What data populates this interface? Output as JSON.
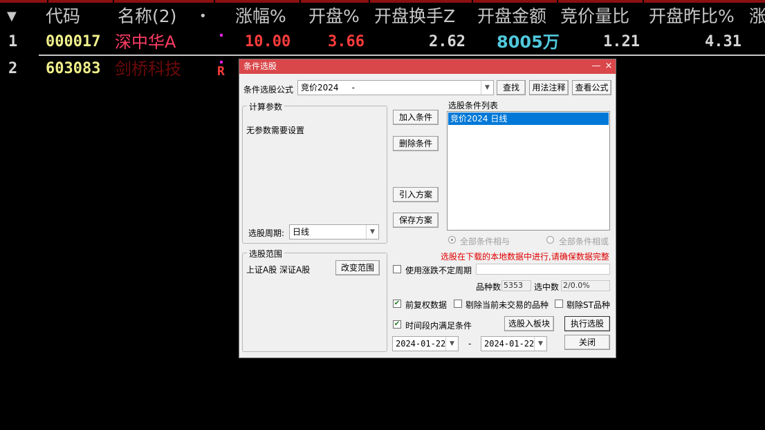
{
  "table": {
    "columns": [
      {
        "label": "代码"
      },
      {
        "label": "名称(2)"
      },
      {
        "label": "•"
      },
      {
        "label": "涨幅%"
      },
      {
        "label": "开盘%"
      },
      {
        "label": "开盘换手Z"
      },
      {
        "label": "开盘金额"
      },
      {
        "label": "竞价量比"
      },
      {
        "label": "开盘昨比%"
      },
      {
        "label": "涨"
      }
    ],
    "sort_indicator": "▼",
    "rows": [
      {
        "index": "1",
        "code": "000017",
        "name": "深中华A",
        "chg": "10.00",
        "open_pct": "3.66",
        "turnover": "2.62",
        "amount": "8005万",
        "vol_ratio": "1.21",
        "open_prev": "4.31"
      },
      {
        "index": "2",
        "code": "603083",
        "name": "剑桥科技",
        "flag": "R"
      }
    ]
  },
  "dialog": {
    "title": "条件选股",
    "minimize": "—",
    "close": "×",
    "formula_label": "条件选股公式",
    "formula_value": "竞价2024     -",
    "find_button": "查找",
    "usage_button": "用法注释",
    "view_formula_button": "查看公式",
    "params_group": "计算参数",
    "params_text": "无参数需要设置",
    "period_label": "选股周期:",
    "period_value": "日线",
    "add_condition": "加入条件",
    "delete_condition": "删除条件",
    "import_plan": "引入方案",
    "save_plan": "保存方案",
    "condition_list_label": "选股条件列表",
    "condition_items": [
      "竞价2024  日线"
    ],
    "radio_and": "全部条件相与",
    "radio_or": "全部条件相或",
    "warning": "选股在下载的本地数据中进行,请确保数据完整",
    "variable_period_label": "使用涨跌不定周期",
    "scope_group": "选股范围",
    "scope_text": "上证A股 深证A股",
    "change_scope": "改变范围",
    "count_label": "品种数",
    "count_value": "5353",
    "selected_label": "选中数",
    "selected_value": "2/0.0%",
    "fq_label": "前复权数据",
    "exclude_untraded_label": "剔除当前未交易的品种",
    "exclude_st_label": "剔除ST品种",
    "time_range_label": "时间段内满足条件",
    "to_block_button": "选股入板块",
    "execute_button": "执行选股",
    "close_button": "关闭",
    "date_from": "2024-01-22",
    "date_separator": "-",
    "date_to": "2024-01-22"
  },
  "colors": {
    "code": "#f0f08c",
    "name_row1": "#ff3c64",
    "name_row2": "#6b0a0a",
    "red_value": "#ff3c3c",
    "white_value": "#d7d7d7",
    "cyan_value": "#50c8dc",
    "title_bar": "#d9474a",
    "warning": "#e00000"
  }
}
